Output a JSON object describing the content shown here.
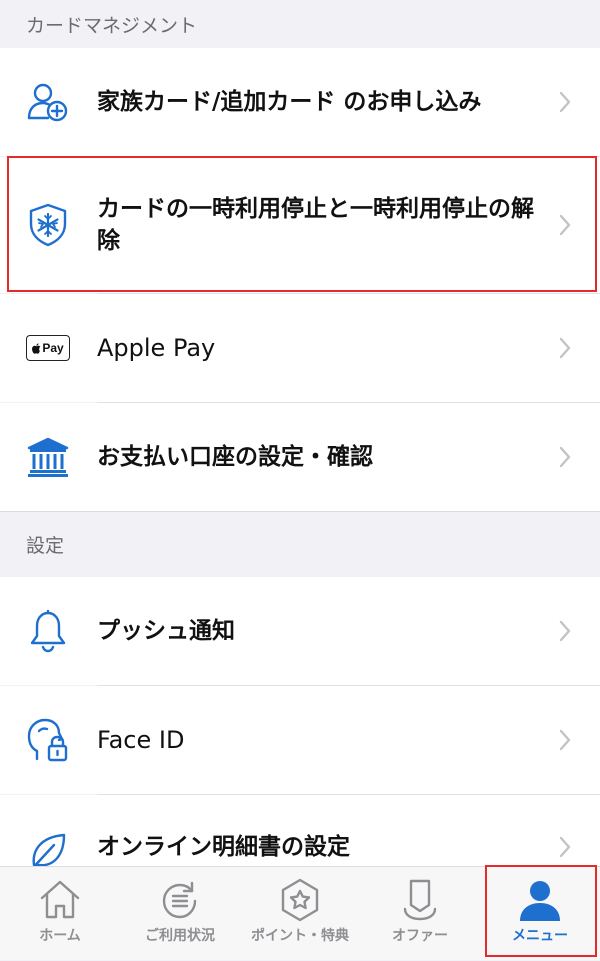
{
  "sections": {
    "card_management": {
      "title": "カードマネジメント",
      "items": [
        {
          "label": "家族カード/追加カード のお申し込み",
          "icon": "add-user-icon"
        },
        {
          "label": "カードの一時利用停止と一時利用停止の解除",
          "icon": "snowflake-shield-icon"
        },
        {
          "label": "Apple Pay",
          "icon": "apple-pay-icon"
        },
        {
          "label": "お支払い口座の設定・確認",
          "icon": "bank-icon"
        }
      ]
    },
    "settings": {
      "title": "設定",
      "items": [
        {
          "label": "プッシュ通知",
          "icon": "bell-icon"
        },
        {
          "label": "Face ID",
          "icon": "face-id-icon"
        },
        {
          "label": "オンライン明細書の設定",
          "icon": "leaf-icon"
        }
      ]
    }
  },
  "apple_pay_badge": "Pay",
  "tabbar": {
    "tabs": [
      {
        "label": "ホーム",
        "icon": "home-icon",
        "active": false
      },
      {
        "label": "ご利用状況",
        "icon": "usage-icon",
        "active": false
      },
      {
        "label": "ポイント・特典",
        "icon": "points-star-icon",
        "active": false
      },
      {
        "label": "オファー",
        "icon": "offer-icon",
        "active": false
      },
      {
        "label": "メニュー",
        "icon": "user-icon",
        "active": true
      }
    ]
  },
  "colors": {
    "accent": "#1f6fce",
    "highlight": "#e32b2b",
    "inactive_tab": "#8e8e93",
    "background": "#f2f2f6"
  }
}
